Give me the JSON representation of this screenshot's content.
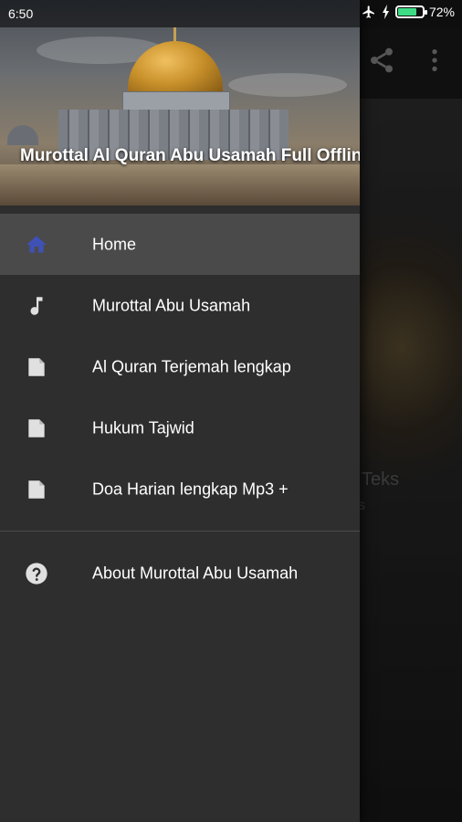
{
  "status_bar": {
    "time": "6:50",
    "battery": "72%"
  },
  "drawer": {
    "header_title": "Murottal Al Quran Abu Usamah Full Offline",
    "items": [
      {
        "label": "Home",
        "icon": "home-icon",
        "active": true
      },
      {
        "label": "Murottal Abu Usamah",
        "icon": "music-note-icon"
      },
      {
        "label": "Al Quran Terjemah lengkap",
        "icon": "document-icon"
      },
      {
        "label": "Hukum Tajwid",
        "icon": "document-icon"
      },
      {
        "label": "Doa Harian lengkap Mp3 +",
        "icon": "document-icon"
      }
    ],
    "secondary_items": [
      {
        "label": "About Murottal Abu Usamah",
        "icon": "help-icon"
      }
    ]
  },
  "background": {
    "partial_text_1": "Teks",
    "partial_text_2": "s"
  },
  "colors": {
    "active_icon": "#3f51b5",
    "drawer_bg": "#2e2e2e",
    "active_row": "#4a4a4a"
  }
}
